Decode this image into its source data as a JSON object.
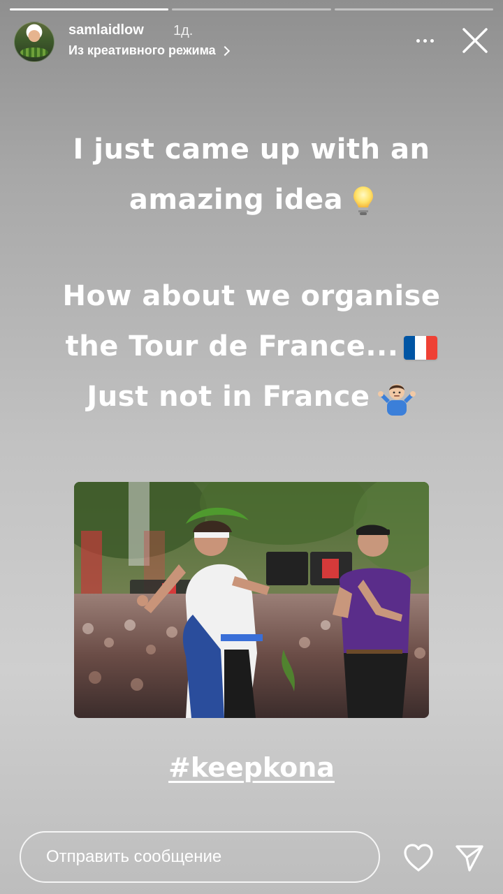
{
  "progress": {
    "segments": [
      {
        "fill": 1.0
      },
      {
        "fill": 0.0
      },
      {
        "fill": 0.0
      }
    ]
  },
  "header": {
    "username": "samlaidlow",
    "time": "1д.",
    "subtitle": "Из креативного режима",
    "icons": {
      "more": "more-horizontal-icon",
      "close": "close-icon",
      "chevron": "chevron-right-icon"
    }
  },
  "story": {
    "block1": {
      "line1": "I just came up with an",
      "line2": "amazing idea"
    },
    "block2": {
      "line1": "How about we organise",
      "line2": "the Tour de France...",
      "line3": "Just not in France"
    },
    "emojis": [
      "light-bulb-icon",
      "france-flag-icon",
      "person-shrugging-icon"
    ]
  },
  "photo": {
    "description_icon": "photo-image"
  },
  "hashtag": "#keepkona",
  "footer": {
    "message_placeholder": "Отправить сообщение",
    "icons": {
      "like": "heart-icon",
      "send": "send-icon"
    }
  },
  "colors": {
    "text": "#ffffff",
    "flag_blue": "#0055A4",
    "flag_white": "#ffffff",
    "flag_red": "#EF4135"
  }
}
